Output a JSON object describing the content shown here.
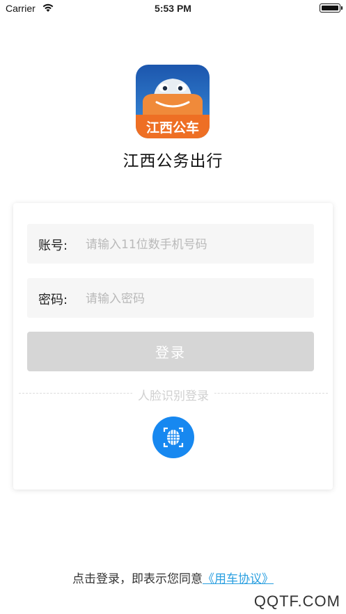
{
  "status_bar": {
    "carrier": "Carrier",
    "time": "5:53 PM",
    "wifi_icon": "wifi-icon",
    "battery_icon": "battery-icon"
  },
  "app": {
    "logo_text": "江西公车",
    "name": "江西公务出行"
  },
  "form": {
    "account_label": "账号:",
    "account_placeholder": "请输入11位数手机号码",
    "account_value": "",
    "password_label": "密码:",
    "password_placeholder": "请输入密码",
    "password_value": "",
    "login_label": "登录",
    "face_login_label": "人脸识别登录",
    "face_icon": "face-recognition-icon"
  },
  "agreement": {
    "prefix": "点击登录，即表示您同意",
    "link": "《用车协议》"
  },
  "watermark": "QQTF.COM",
  "colors": {
    "accent": "#1788f0",
    "link": "#2a9fe0",
    "login_disabled": "#d6d6d6",
    "logo_blue": "#1f63b8",
    "logo_orange": "#ef7a2d"
  }
}
